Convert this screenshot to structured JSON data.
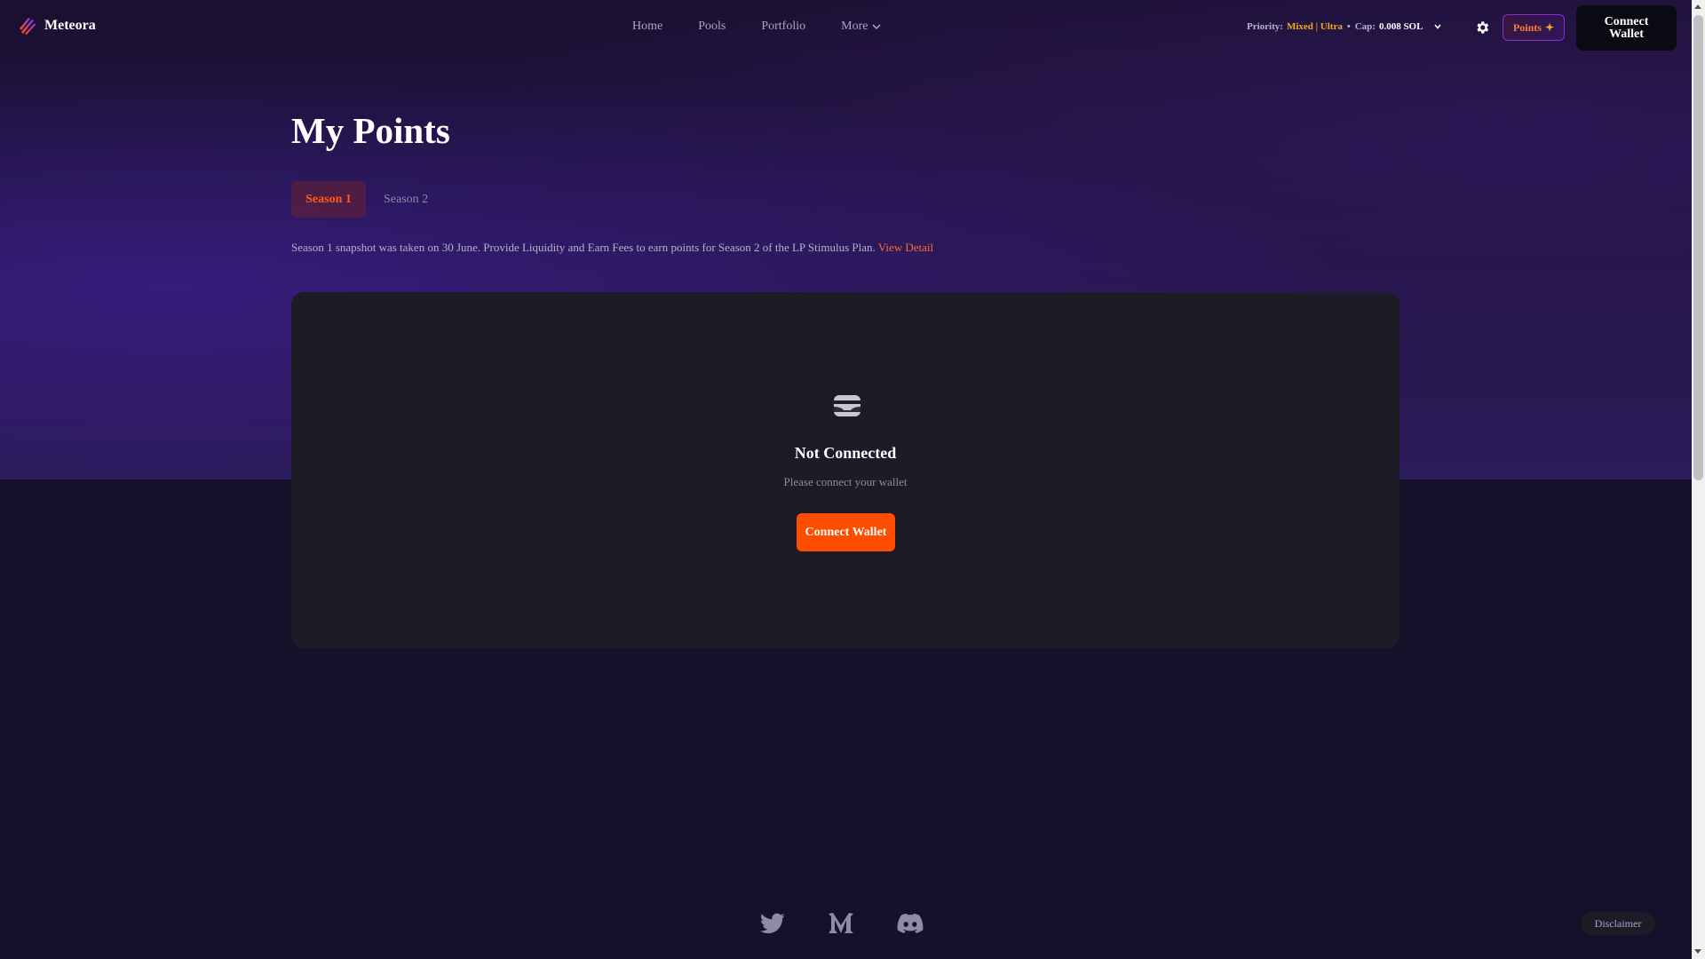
{
  "app": {
    "name": "Meteora"
  },
  "nav": {
    "items": [
      {
        "label": "Home"
      },
      {
        "label": "Pools"
      },
      {
        "label": "Portfolio"
      },
      {
        "label": "More"
      }
    ]
  },
  "priority": {
    "label": "Priority:",
    "mode": "Mixed | Ultra",
    "separator": "•",
    "cap_label": "Cap:",
    "cap_value": "0.008 SOL"
  },
  "header": {
    "points_label": "Points",
    "connect_label": "Connect Wallet"
  },
  "main": {
    "title": "My Points",
    "tabs": [
      {
        "label": "Season 1",
        "active": true
      },
      {
        "label": "Season 2",
        "active": false
      }
    ],
    "info_text": "Season 1 snapshot was taken on 30 June. Provide Liquidity and Earn Fees to earn points for Season 2 of the LP Stimulus Plan.",
    "info_link": "View Detail"
  },
  "empty_state": {
    "icon": "wallet-icon",
    "title": "Not Connected",
    "subtitle": "Please connect your wallet",
    "button_label": "Connect Wallet"
  },
  "footer": {
    "socials": [
      "twitter-icon",
      "medium-icon",
      "discord-icon"
    ],
    "disclaimer_label": "Disclaimer"
  },
  "colors": {
    "accent": "#ff4d00",
    "priority_accent": "#f5a623",
    "card_bg": "#1c1b26",
    "page_bg": "#13122a"
  }
}
